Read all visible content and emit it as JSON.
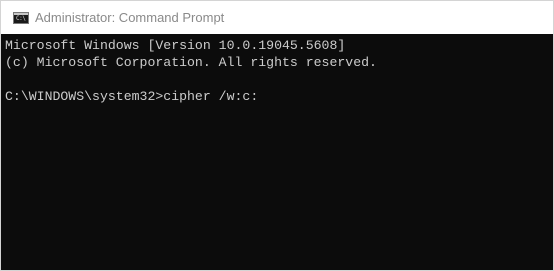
{
  "window": {
    "title": "Administrator: Command Prompt",
    "icon": "cmd-icon",
    "icon_glyph": "C:\\"
  },
  "console": {
    "lines": [
      "Microsoft Windows [Version 10.0.19045.5608]",
      "(c) Microsoft Corporation. All rights reserved.",
      "",
      "C:\\WINDOWS\\system32>cipher /w:c:"
    ]
  },
  "colors": {
    "console_background": "#0c0c0c",
    "console_text": "#cccccc",
    "titlebar_background": "#ffffff",
    "title_text": "#8a8a8a"
  }
}
